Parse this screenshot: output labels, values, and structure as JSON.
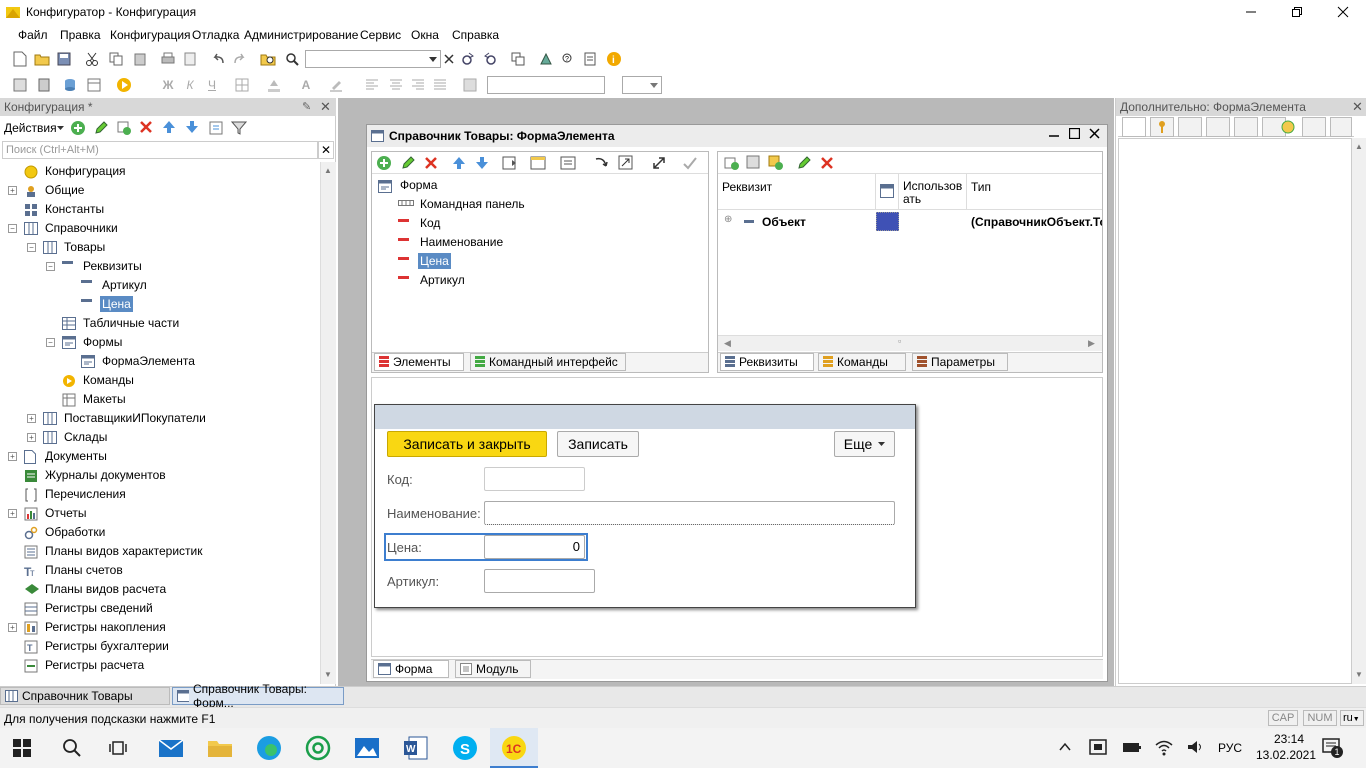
{
  "window": {
    "title": "Конфигуратор - Конфигурация",
    "controls": [
      "—",
      "❐",
      "✕"
    ]
  },
  "menu": [
    "Файл",
    "Правка",
    "Конфигурация",
    "Отладка",
    "Администрирование",
    "Сервис",
    "Окна",
    "Справка"
  ],
  "left_panel": {
    "title": "Конфигурация *",
    "actions_label": "Действия",
    "search_placeholder": "Поиск (Ctrl+Alt+M)",
    "tree": [
      {
        "label": "Конфигурация",
        "level": 0,
        "exp": "",
        "icon": "configuration-icon"
      },
      {
        "label": "Общие",
        "level": 0,
        "exp": "+",
        "icon": "common-icon"
      },
      {
        "label": "Константы",
        "level": 0,
        "exp": "",
        "icon": "constants-icon"
      },
      {
        "label": "Справочники",
        "level": 0,
        "exp": "−",
        "icon": "catalog-icon"
      },
      {
        "label": "Товары",
        "level": 1,
        "exp": "−",
        "icon": "catalog-icon"
      },
      {
        "label": "Реквизиты",
        "level": 2,
        "exp": "−",
        "icon": "attribute-icon"
      },
      {
        "label": "Артикул",
        "level": 3,
        "exp": "",
        "icon": "attribute-icon"
      },
      {
        "label": "Цена",
        "level": 3,
        "exp": "",
        "icon": "attribute-icon",
        "selected": true
      },
      {
        "label": "Табличные части",
        "level": 2,
        "exp": "",
        "icon": "table-icon"
      },
      {
        "label": "Формы",
        "level": 2,
        "exp": "−",
        "icon": "form-icon"
      },
      {
        "label": "ФормаЭлемента",
        "level": 3,
        "exp": "",
        "icon": "form-icon"
      },
      {
        "label": "Команды",
        "level": 2,
        "exp": "",
        "icon": "command-icon"
      },
      {
        "label": "Макеты",
        "level": 2,
        "exp": "",
        "icon": "template-icon"
      },
      {
        "label": "ПоставщикиИПокупатели",
        "level": 1,
        "exp": "+",
        "icon": "catalog-icon"
      },
      {
        "label": "Склады",
        "level": 1,
        "exp": "+",
        "icon": "catalog-icon"
      },
      {
        "label": "Документы",
        "level": 0,
        "exp": "+",
        "icon": "document-icon"
      },
      {
        "label": "Журналы документов",
        "level": 0,
        "exp": "",
        "icon": "journal-icon"
      },
      {
        "label": "Перечисления",
        "level": 0,
        "exp": "",
        "icon": "enum-icon"
      },
      {
        "label": "Отчеты",
        "level": 0,
        "exp": "+",
        "icon": "report-icon"
      },
      {
        "label": "Обработки",
        "level": 0,
        "exp": "",
        "icon": "processing-icon"
      },
      {
        "label": "Планы видов характеристик",
        "level": 0,
        "exp": "",
        "icon": "chart-char-icon"
      },
      {
        "label": "Планы счетов",
        "level": 0,
        "exp": "",
        "icon": "accounts-icon"
      },
      {
        "label": "Планы видов расчета",
        "level": 0,
        "exp": "",
        "icon": "calc-types-icon"
      },
      {
        "label": "Регистры сведений",
        "level": 0,
        "exp": "",
        "icon": "info-register-icon"
      },
      {
        "label": "Регистры накопления",
        "level": 0,
        "exp": "+",
        "icon": "accum-register-icon"
      },
      {
        "label": "Регистры бухгалтерии",
        "level": 0,
        "exp": "",
        "icon": "acc-register-icon"
      },
      {
        "label": "Регистры расчета",
        "level": 0,
        "exp": "",
        "icon": "calc-register-icon"
      }
    ]
  },
  "doc_window": {
    "title": "Справочник Товары: ФормаЭлемента",
    "elements_tree": [
      {
        "label": "Форма",
        "level": 0,
        "icon": "form-icon"
      },
      {
        "label": "Командная панель",
        "level": 1,
        "icon": "command-bar-icon"
      },
      {
        "label": "Код",
        "level": 1,
        "icon": "field-icon"
      },
      {
        "label": "Наименование",
        "level": 1,
        "icon": "field-icon"
      },
      {
        "label": "Цена",
        "level": 1,
        "icon": "field-icon",
        "selected": true
      },
      {
        "label": "Артикул",
        "level": 1,
        "icon": "field-icon"
      }
    ],
    "attr_headers": [
      "Реквизит",
      "Использов ать",
      "Тип"
    ],
    "attr_rows": [
      {
        "name": "Объект",
        "type": "(СправочникОбъект.То"
      }
    ],
    "left_tabs": [
      "Элементы",
      "Командный интерфейс"
    ],
    "right_tabs": [
      "Реквизиты",
      "Команды",
      "Параметры"
    ],
    "bottom_tabs": [
      "Форма",
      "Модуль"
    ]
  },
  "form_preview": {
    "save_close": "Записать и закрыть",
    "save": "Записать",
    "more": "Еще",
    "fields": [
      {
        "label": "Код:",
        "value": ""
      },
      {
        "label": "Наименование:",
        "value": ""
      },
      {
        "label": "Цена:",
        "value": "0"
      },
      {
        "label": "Артикул:",
        "value": ""
      }
    ]
  },
  "right_panel": {
    "title": "Дополнительно: ФормаЭлемента"
  },
  "open_windows": [
    "Справочник Товары",
    "Справочник Товары: Форм..."
  ],
  "status": {
    "hint": "Для получения подсказки нажмите F1",
    "cap": "CAP",
    "num": "NUM",
    "lang": "ru"
  },
  "taskbar": {
    "lang": "РУС",
    "time": "23:14",
    "date": "13.02.2021",
    "notifications": "1"
  },
  "colors": {
    "accent_yellow": "#f9d712",
    "selection": "#5a8bc4",
    "focus_border": "#3d7ecf"
  }
}
